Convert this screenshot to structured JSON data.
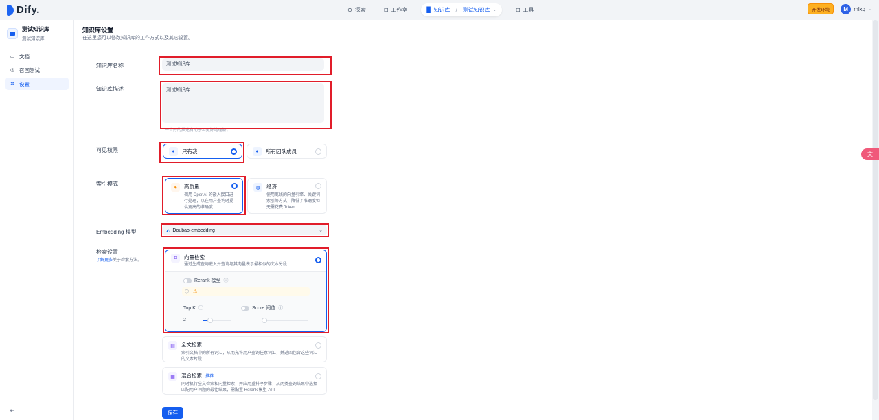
{
  "app": {
    "logo_text": "Dify."
  },
  "topnav": {
    "explore": "探索",
    "studio": "工作室",
    "datasets": "知识库",
    "current_dataset": "测试知识库",
    "tools": "工具"
  },
  "topright": {
    "env_badge": "开发环境",
    "avatar_letter": "M",
    "user": "mlxq"
  },
  "sidebar": {
    "dataset_name": "测试知识库",
    "dataset_sub": "测试知识库",
    "items": [
      {
        "label": "文档",
        "icon": "document-icon"
      },
      {
        "label": "召回测试",
        "icon": "target-icon"
      },
      {
        "label": "设置",
        "icon": "gear-icon"
      }
    ]
  },
  "settings": {
    "title": "知识库设置",
    "subtitle": "在这里您可以修改知识库的工作方式以及其它设置。",
    "name_label": "知识库名称",
    "name_value": "测试知识库",
    "desc_label": "知识库描述",
    "desc_value": "测试知识库",
    "desc_hint": "一个好的描述有助于AI更好地理解。",
    "permission_label": "可见权限",
    "perm_only_me": "只有我",
    "perm_all_members": "所有团队成员",
    "index_label": "索引模式",
    "index_high": "高质量",
    "index_high_desc": "调用 OpenAI 的嵌入接口进行处理，以在用户查询时提供更高的准确度",
    "index_eco": "经济",
    "index_eco_desc": "使用离线的向量引擎、关键词索引等方式，降低了准确度但无需花费 Token",
    "embedding_label": "Embedding 模型",
    "embedding_value": "Doubao-embedding",
    "retrieval_label": "检索设置",
    "retrieval_link": "了解更多",
    "retrieval_link_suffix": "关于检索方法。",
    "vector_title": "向量检索",
    "vector_desc": "通过生成查询嵌入并查询与其向量表示最相似的文本分段",
    "rerank_label": "Rerank 模型",
    "topk_label": "Top K",
    "topk_value": "2",
    "score_label": "Score 阈值",
    "fulltext_title": "全文检索",
    "fulltext_desc": "索引文档中的所有词汇，从而允许用户查询任意词汇，并返回包含这些词汇的文本片段",
    "hybrid_title": "混合检索",
    "hybrid_tag": "推荐",
    "hybrid_desc": "同时执行全文检索和向量检索，并应用重排序步骤，从两类查询结果中选择匹配用户问题的最佳结果，需配置 Rerank 模型 API",
    "save": "保存"
  },
  "colors": {
    "accent": "#155eef",
    "highlight": "#e11d2a",
    "badge": "#fdb022"
  }
}
